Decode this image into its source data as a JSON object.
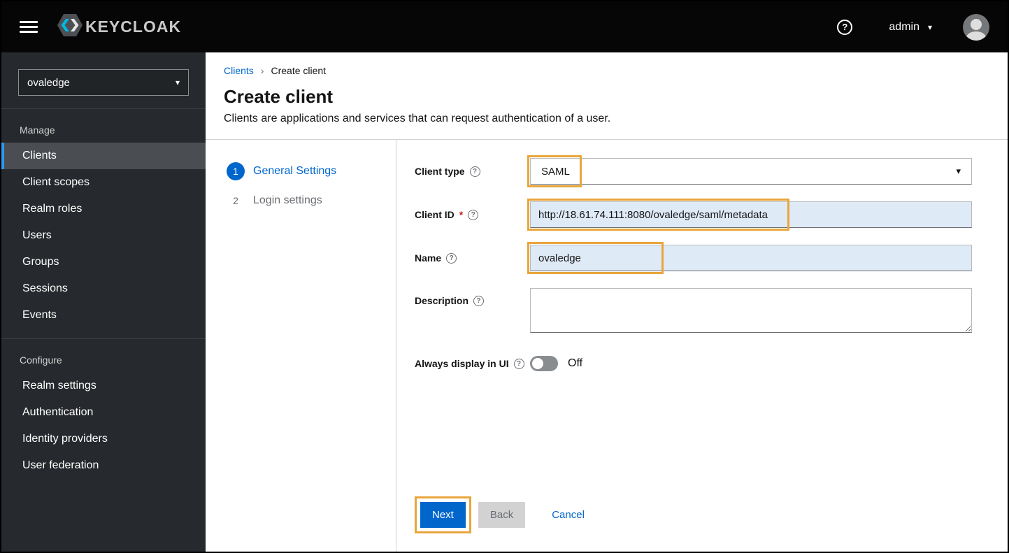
{
  "colors": {
    "primary_blue": "#0066cc",
    "topbar_bg": "#060606",
    "sidebar_bg": "#26292d",
    "annotation_highlight": "#e9a63c",
    "input_highlight_bg": "#dfeaf7",
    "required_red": "#c9190b"
  },
  "icons": {
    "caret_down": "▾",
    "breadcrumb_separator": "›",
    "help_glyph": "?"
  },
  "topbar": {
    "brand": "KEYCLOAK",
    "user_menu": {
      "label": "admin"
    }
  },
  "sidebar": {
    "realm_selector": {
      "value": "ovaledge"
    },
    "sections": [
      {
        "label": "Manage",
        "items": [
          {
            "label": "Clients",
            "active": true
          },
          {
            "label": "Client scopes"
          },
          {
            "label": "Realm roles"
          },
          {
            "label": "Users"
          },
          {
            "label": "Groups"
          },
          {
            "label": "Sessions"
          },
          {
            "label": "Events"
          }
        ]
      },
      {
        "label": "Configure",
        "items": [
          {
            "label": "Realm settings"
          },
          {
            "label": "Authentication"
          },
          {
            "label": "Identity providers"
          },
          {
            "label": "User federation"
          }
        ]
      }
    ]
  },
  "breadcrumb": {
    "items": [
      {
        "label": "Clients"
      },
      {
        "label": "Create client"
      }
    ]
  },
  "page": {
    "title": "Create client",
    "subtitle": "Clients are applications and services that can request authentication of a user."
  },
  "wizard": {
    "steps": [
      {
        "number": "1",
        "label": "General Settings",
        "active": true
      },
      {
        "number": "2",
        "label": "Login settings",
        "active": false
      }
    ]
  },
  "form": {
    "client_type": {
      "label": "Client type",
      "value": "SAML"
    },
    "client_id": {
      "label": "Client ID",
      "required": "*",
      "value": "http://18.61.74.111:8080/ovaledge/saml/metadata"
    },
    "name": {
      "label": "Name",
      "value": "ovaledge"
    },
    "description": {
      "label": "Description",
      "value": ""
    },
    "always_display": {
      "label": "Always display in UI",
      "state": "Off"
    }
  },
  "actions": {
    "next": "Next",
    "back": "Back",
    "cancel": "Cancel"
  }
}
